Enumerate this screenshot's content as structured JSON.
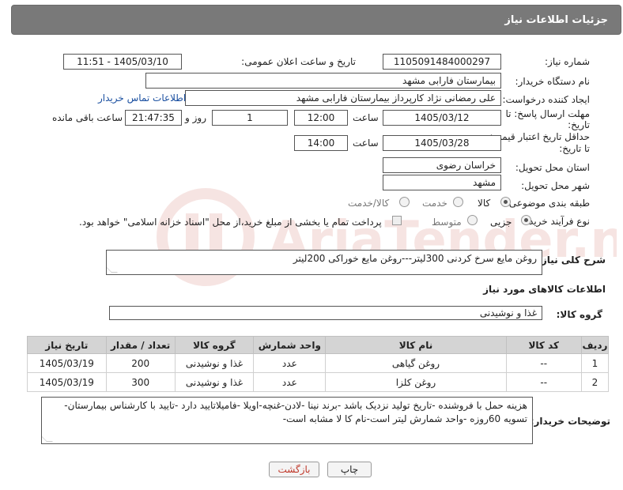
{
  "header": {
    "title": "جزئیات اطلاعات نیاز"
  },
  "form": {
    "need_number": {
      "label": "شماره نیاز:",
      "value": "1105091484000297"
    },
    "announce_datetime": {
      "label": "تاریخ و ساعت اعلان عمومی:",
      "value": "1405/03/10 - 11:51"
    },
    "buyer_org": {
      "label": "نام دستگاه خریدار:",
      "value": "بیمارستان فارابی مشهد"
    },
    "requester": {
      "label": "ایجاد کننده درخواست:",
      "value": "علی رمضانی نژاد کارپرداز بیمارستان فارابی مشهد",
      "contact_link": "اطلاعات تماس خریدار"
    },
    "reply_deadline": {
      "label_line1": "مهلت ارسال پاسخ: تا",
      "label_line2": "تاریخ:",
      "date": "1405/03/12",
      "time_label": "ساعت",
      "time": "12:00",
      "days": "1",
      "days_label": "روز و",
      "remaining": "21:47:35",
      "remaining_label": "ساعت باقی مانده"
    },
    "price_validity": {
      "label_line1": "حداقل تاریخ اعتبار قیمت:",
      "label_line2": "تا تاریخ:",
      "date": "1405/03/28",
      "time_label": "ساعت",
      "time": "14:00"
    },
    "delivery_province": {
      "label": "استان محل تحویل:",
      "value": "خراسان رضوی"
    },
    "delivery_city": {
      "label": "شهر محل تحویل:",
      "value": "مشهد"
    },
    "category": {
      "label": "طبقه بندی موضوعی:",
      "options": [
        "کالا",
        "خدمت",
        "کالا/خدمت"
      ],
      "selected": "کالا"
    },
    "process_type": {
      "label": "نوع فرآیند خرید :",
      "options": [
        "جزیی",
        "متوسط"
      ],
      "selected": "جزیی",
      "payment_note": "پرداخت تمام یا بخشی از مبلغ خرید،از محل \"اسناد خزانه اسلامی\" خواهد بود."
    },
    "description": {
      "label": "شرح کلی نیاز:",
      "value": "روغن مایع سرخ کردنی 300لیتر---روغن مایع خوراکی 200لیتر"
    },
    "items_section_title": "اطلاعات کالاهای مورد نیاز",
    "goods_group": {
      "label": "گروه کالا:",
      "value": "غذا و نوشیدنی"
    },
    "buyer_notes": {
      "label": "توضیحات خریدار:",
      "value": "هزینه حمل با فروشنده -تاریخ تولید نزدیک باشد -برند نینا -لادن-غنچه-اویلا -فامیلاتایید دارد -تایید با کارشناس بیمارستان-تسویه 60روزه -واحد شمارش لیتر است-نام کا لا مشابه است-"
    }
  },
  "table": {
    "headers": [
      "ردیف",
      "کد کالا",
      "نام کالا",
      "واحد شمارش",
      "گروه کالا",
      "تعداد / مقدار",
      "تاریخ نیاز"
    ],
    "rows": [
      [
        "1",
        "--",
        "روغن گیاهی",
        "عدد",
        "غذا و نوشیدنی",
        "200",
        "1405/03/19"
      ],
      [
        "2",
        "--",
        "روغن کلزا",
        "عدد",
        "غذا و نوشیدنی",
        "300",
        "1405/03/19"
      ]
    ]
  },
  "buttons": {
    "print": "چاپ",
    "back": "بازگشت"
  },
  "watermark": {
    "brand": "AriaTender.neT"
  },
  "colors": {
    "header_bg": "#797979",
    "link": "#1a4fa0",
    "back_button_text": "#c0392b",
    "watermark": "#c0392b"
  }
}
